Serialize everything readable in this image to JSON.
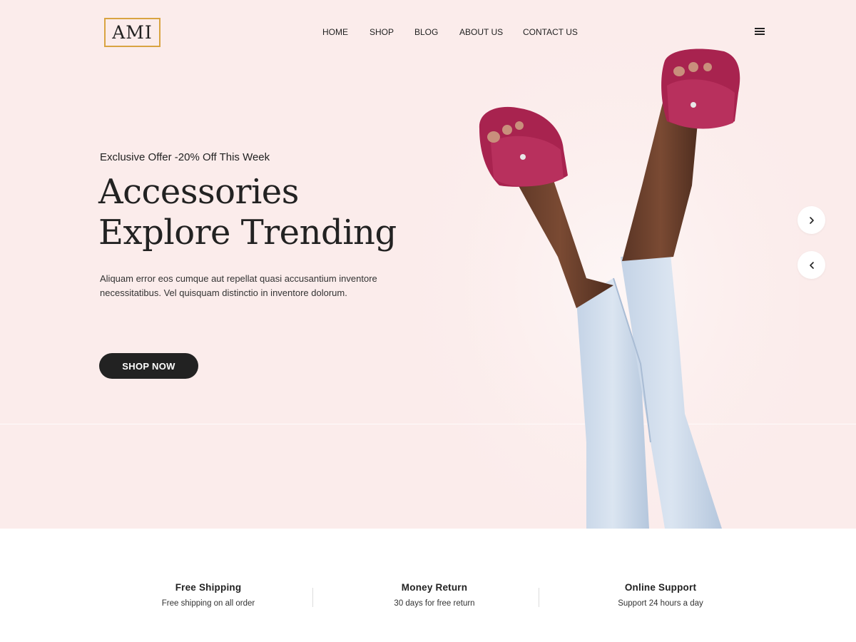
{
  "brand": {
    "logo_text": "AMI",
    "accent_color": "#d9a441"
  },
  "nav": {
    "items": [
      "HOME",
      "SHOP",
      "BLOG",
      "ABOUT US",
      "CONTACT US"
    ],
    "menu_icon": "hamburger-menu-icon"
  },
  "hero": {
    "offer": "Exclusive Offer -20% Off This Week",
    "title_line1": "Accessories",
    "title_line2": "Explore Trending",
    "description": "Aliquam error eos cumque aut repellat quasi accusantium inventore necessitatibus. Vel quisquam distinctio in inventore dolorum.",
    "cta_label": "SHOP NOW",
    "background_color": "#fbeceb",
    "image": "legs-in-jeans-wearing-magenta-suede-sandals",
    "next_icon": "chevron-right-icon",
    "prev_icon": "chevron-left-icon"
  },
  "features": [
    {
      "title": "Free Shipping",
      "subtitle": "Free shipping on all order"
    },
    {
      "title": "Money Return",
      "subtitle": "30 days for free return"
    },
    {
      "title": "Online Support",
      "subtitle": "Support 24 hours a day"
    }
  ]
}
